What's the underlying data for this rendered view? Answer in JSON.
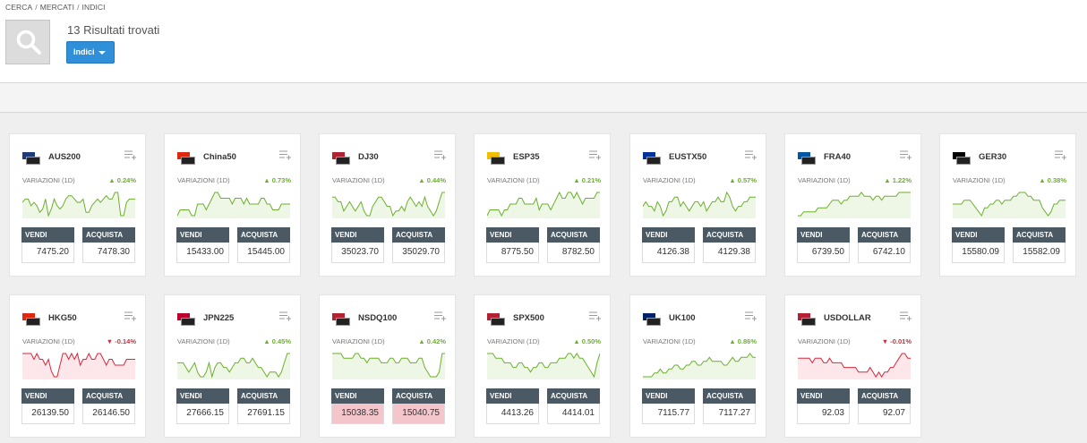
{
  "breadcrumb": [
    "CERCA",
    "MERCATI",
    "INDICI"
  ],
  "results_title": "13 Risultati trovati",
  "filter_button": "Indici",
  "variation_label": "VARIAZIONI (1D)",
  "sell_label": "VENDI",
  "buy_label": "ACQUISTA",
  "colors": {
    "up": "#6cb02c",
    "down": "#d8283a",
    "button": "#2f8fd8",
    "tile_header": "#4a5963"
  },
  "instruments": [
    {
      "name": "AUS200",
      "flag": "flag-australia-icon",
      "flag_color": "#1e3a78",
      "change": "▲ 0.24%",
      "dir": "up",
      "sell": "7475.20",
      "buy": "7478.30",
      "trend": [
        5,
        6,
        6,
        4,
        5,
        4,
        2,
        3,
        6,
        1,
        3,
        6,
        4,
        3,
        4,
        6,
        7,
        7,
        6,
        5,
        5,
        6,
        2,
        2,
        4,
        5,
        6,
        5,
        6,
        7,
        6,
        6,
        8,
        8,
        1,
        1,
        5,
        6,
        6,
        6
      ]
    },
    {
      "name": "China50",
      "flag": "flag-china-icon",
      "flag_color": "#de2910",
      "change": "▲ 0.73%",
      "dir": "up",
      "sell": "15433.00",
      "buy": "15445.00",
      "trend": [
        2,
        3,
        3,
        3,
        3,
        2,
        2,
        4,
        4,
        4,
        3,
        4,
        5,
        6,
        6,
        5,
        5,
        5,
        5,
        4,
        5,
        5,
        5,
        4,
        5,
        4,
        4,
        4,
        4,
        5,
        5,
        4,
        4,
        3,
        3,
        3,
        4,
        4,
        4,
        4
      ]
    },
    {
      "name": "DJ30",
      "flag": "flag-usa-icon",
      "flag_color": "#b22234",
      "change": "▲ 0.44%",
      "dir": "up",
      "sell": "35023.70",
      "buy": "35029.70",
      "trend": [
        6,
        6,
        5,
        5,
        3,
        4,
        5,
        4,
        3,
        4,
        5,
        3,
        2,
        2,
        4,
        5,
        6,
        6,
        5,
        4,
        4,
        2,
        3,
        3,
        4,
        3,
        5,
        6,
        5,
        4,
        5,
        4,
        6,
        4,
        3,
        2,
        3,
        5,
        7,
        7
      ]
    },
    {
      "name": "ESP35",
      "flag": "flag-spain-icon",
      "flag_color": "#f1bf00",
      "change": "▲ 0.21%",
      "dir": "up",
      "sell": "8775.50",
      "buy": "8782.50",
      "trend": [
        2,
        3,
        3,
        3,
        3,
        2,
        3,
        3,
        4,
        4,
        4,
        5,
        5,
        4,
        4,
        4,
        4,
        5,
        3,
        4,
        4,
        4,
        3,
        4,
        5,
        6,
        5,
        5,
        6,
        6,
        5,
        6,
        5,
        4,
        5,
        5,
        5,
        5,
        6,
        6
      ]
    },
    {
      "name": "EUSTX50",
      "flag": "flag-eu-icon",
      "flag_color": "#003399",
      "change": "▲ 0.57%",
      "dir": "up",
      "sell": "4126.38",
      "buy": "4129.38",
      "trend": [
        5,
        6,
        5,
        5,
        4,
        6,
        5,
        3,
        4,
        6,
        6,
        7,
        7,
        5,
        6,
        5,
        4,
        5,
        6,
        6,
        5,
        6,
        4,
        5,
        6,
        6,
        7,
        6,
        6,
        8,
        7,
        5,
        4,
        5,
        5,
        6,
        6,
        7,
        7,
        7
      ]
    },
    {
      "name": "FRA40",
      "flag": "flag-france-icon",
      "flag_color": "#0055a4",
      "change": "▲ 1.22%",
      "dir": "up",
      "sell": "6739.50",
      "buy": "6742.10",
      "trend": [
        2,
        2,
        3,
        3,
        3,
        3,
        3,
        4,
        4,
        4,
        4,
        5,
        6,
        6,
        6,
        5,
        6,
        6,
        7,
        7,
        7,
        7,
        8,
        7,
        7,
        7,
        6,
        7,
        7,
        6,
        7,
        7,
        7,
        7,
        7,
        8,
        8,
        8,
        8,
        8
      ]
    },
    {
      "name": "GER30",
      "flag": "flag-germany-icon",
      "flag_color": "#000000",
      "change": "▲ 0.38%",
      "dir": "up",
      "sell": "15580.09",
      "buy": "15582.09",
      "trend": [
        5,
        5,
        5,
        5,
        6,
        6,
        6,
        5,
        4,
        3,
        2,
        4,
        4,
        5,
        5,
        6,
        6,
        5,
        6,
        6,
        6,
        7,
        7,
        8,
        8,
        8,
        7,
        7,
        6,
        6,
        6,
        4,
        3,
        2,
        3,
        5,
        5,
        6,
        6,
        6
      ]
    },
    {
      "name": "HKG50",
      "flag": "flag-hongkong-icon",
      "flag_color": "#de2910",
      "change": "▼ -0.14%",
      "dir": "down",
      "sell": "26139.50",
      "buy": "26146.50",
      "trend": [
        6,
        6,
        6,
        6,
        5,
        6,
        5,
        5,
        4,
        5,
        3,
        2,
        2,
        4,
        6,
        6,
        5,
        6,
        5,
        6,
        4,
        5,
        5,
        6,
        5,
        5,
        6,
        6,
        5,
        4,
        5,
        5,
        4,
        4,
        4,
        4,
        5,
        5,
        5,
        5
      ]
    },
    {
      "name": "JPN225",
      "flag": "flag-japan-icon",
      "flag_color": "#bc002d",
      "change": "▲ 0.45%",
      "dir": "up",
      "sell": "27666.15",
      "buy": "27691.15",
      "trend": [
        5,
        5,
        5,
        4,
        3,
        4,
        5,
        3,
        2,
        2,
        3,
        5,
        2,
        4,
        5,
        5,
        4,
        4,
        3,
        4,
        5,
        5,
        6,
        6,
        5,
        5,
        6,
        5,
        4,
        4,
        3,
        2,
        3,
        3,
        3,
        2,
        3,
        5,
        7,
        7
      ]
    },
    {
      "name": "NSDQ100",
      "flag": "flag-usa-icon",
      "flag_color": "#b22234",
      "change": "▲ 0.42%",
      "dir": "up",
      "sell": "15038.35",
      "buy": "15040.75",
      "highlight": true,
      "trend": [
        7,
        7,
        7,
        7,
        6,
        6,
        6,
        6,
        7,
        7,
        6,
        6,
        5,
        6,
        6,
        6,
        6,
        5,
        5,
        5,
        6,
        6,
        5,
        5,
        6,
        6,
        6,
        5,
        5,
        5,
        6,
        6,
        4,
        3,
        2,
        2,
        2,
        3,
        7,
        7
      ]
    },
    {
      "name": "SPX500",
      "flag": "flag-usa-icon",
      "flag_color": "#b22234",
      "change": "▲ 0.50%",
      "dir": "up",
      "sell": "4413.26",
      "buy": "4414.01",
      "trend": [
        7,
        7,
        7,
        6,
        6,
        6,
        5,
        5,
        5,
        4,
        4,
        5,
        5,
        4,
        4,
        3,
        4,
        4,
        5,
        5,
        4,
        4,
        5,
        5,
        5,
        6,
        6,
        6,
        7,
        7,
        6,
        7,
        6,
        6,
        5,
        4,
        3,
        2,
        5,
        7
      ]
    },
    {
      "name": "UK100",
      "flag": "flag-uk-icon",
      "flag_color": "#012169",
      "change": "▲ 0.86%",
      "dir": "up",
      "sell": "7115.77",
      "buy": "7117.27",
      "trend": [
        2,
        2,
        2,
        2,
        3,
        3,
        4,
        3,
        3,
        4,
        4,
        5,
        5,
        4,
        4,
        5,
        5,
        6,
        6,
        5,
        5,
        6,
        6,
        7,
        6,
        6,
        6,
        6,
        5,
        5,
        6,
        7,
        6,
        6,
        7,
        7,
        7,
        8,
        7,
        7
      ]
    },
    {
      "name": "USDOLLAR",
      "flag": "flag-usa-icon",
      "flag_color": "#b22234",
      "change": "▼ -0.01%",
      "dir": "down",
      "sell": "92.03",
      "buy": "92.07",
      "trend": [
        6,
        6,
        6,
        6,
        6,
        5,
        6,
        6,
        6,
        5,
        5,
        6,
        5,
        5,
        5,
        5,
        4,
        4,
        4,
        4,
        4,
        3,
        3,
        3,
        3,
        4,
        3,
        2,
        3,
        2,
        3,
        3,
        4,
        4,
        5,
        6,
        7,
        7,
        6,
        6
      ]
    }
  ]
}
